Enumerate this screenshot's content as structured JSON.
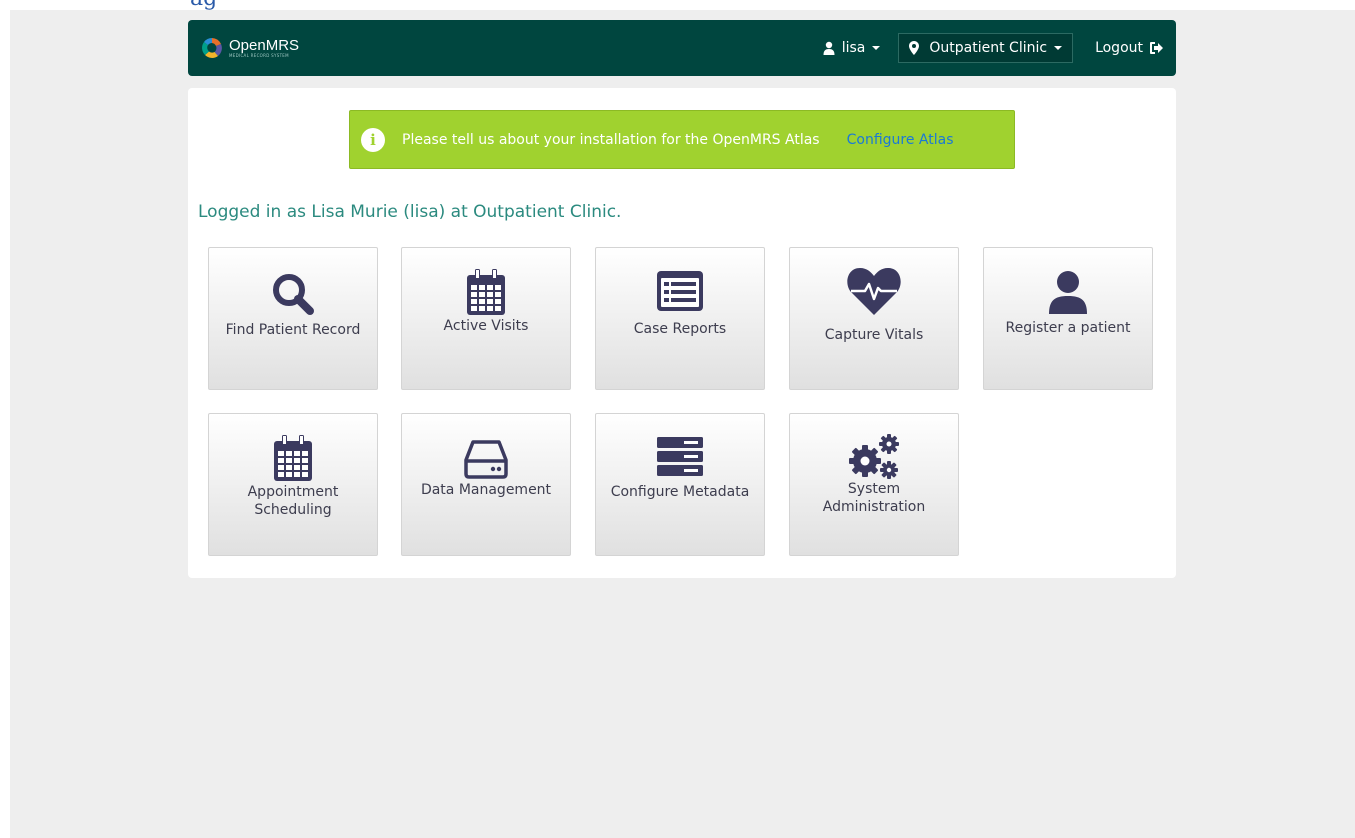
{
  "colors": {
    "header_bg": "#00463f",
    "alert_bg": "#a0d22f",
    "link": "#1a79d6",
    "welcome_text": "#2b8a7f",
    "icon": "#3b3a5f"
  },
  "header": {
    "logo_name": "OpenMRS",
    "logo_tagline": "MEDICAL RECORD SYSTEM",
    "user": "lisa",
    "location": "Outpatient Clinic",
    "logout": "Logout"
  },
  "alert": {
    "message": "Please tell us about your installation for the OpenMRS Atlas",
    "link": "Configure Atlas"
  },
  "welcome": "Logged in as Lisa Murie (lisa) at Outpatient Clinic.",
  "apps": [
    {
      "label": "Find Patient Record",
      "icon": "search-icon"
    },
    {
      "label": "Active Visits",
      "icon": "calendar-icon"
    },
    {
      "label": "Case Reports",
      "icon": "list-alt-icon"
    },
    {
      "label": "Capture Vitals",
      "icon": "heartbeat-icon"
    },
    {
      "label": "Register a patient",
      "icon": "user-icon"
    },
    {
      "label": "Appointment Scheduling",
      "icon": "calendar-icon"
    },
    {
      "label": "Data Management",
      "icon": "hdd-icon"
    },
    {
      "label": "Configure Metadata",
      "icon": "server-icon"
    },
    {
      "label": "System Administration",
      "icon": "gears-icon"
    }
  ]
}
